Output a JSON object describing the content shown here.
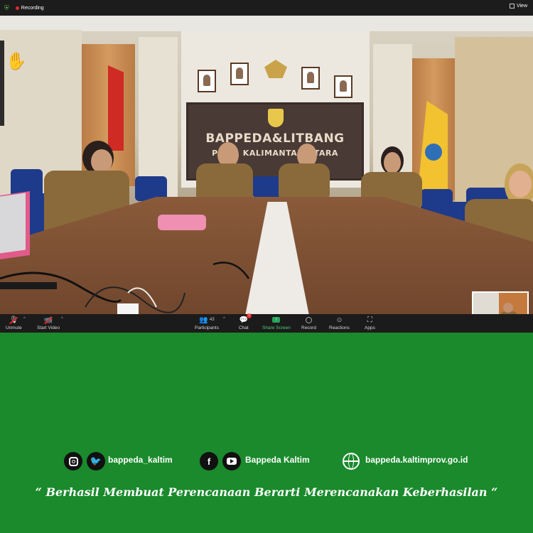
{
  "topbar": {
    "recording_label": "Recording",
    "view_label": "View"
  },
  "meeting_room": {
    "board_title": "BAPPEDA&LITBANG",
    "board_subtitle": "PROV. KALIMANTAN UTARA"
  },
  "toolbar": {
    "unmute_label": "Unmute",
    "start_video_label": "Start Video",
    "participants_label": "Participants",
    "participants_count": "43",
    "chat_label": "Chat",
    "chat_badge": "1",
    "share_screen_label": "Share Screen",
    "record_label": "Record",
    "reactions_label": "Reactions",
    "apps_label": "Apps"
  },
  "footer": {
    "instagram_twitter_handle": "bappeda_kaltim",
    "facebook_youtube_name": "Bappeda Kaltim",
    "website": "bappeda.kaltimprov.go.id",
    "tagline": "“ Berhasil  Membuat Perencanaan Berarti Merencanakan Keberhasilan “"
  },
  "colors": {
    "background_green": "#1a8a2c",
    "toolbar_dark": "#1b1b1b",
    "share_green": "#26a35a",
    "record_red": "#e02828"
  },
  "icons": {
    "raise_hand": "raised-hand-icon",
    "shield": "security-shield-icon"
  }
}
